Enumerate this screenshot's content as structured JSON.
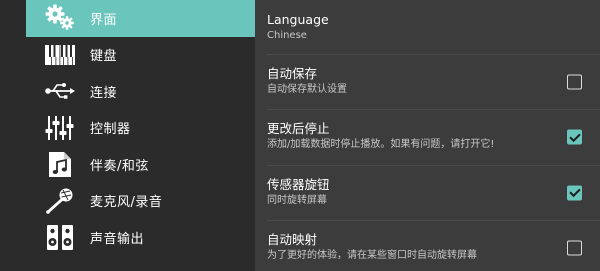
{
  "colors": {
    "accent": "#6ac5bc",
    "sidebar_bg": "#2b2b2b",
    "content_bg": "#3c3c3c"
  },
  "sidebar": {
    "items": [
      {
        "label": "界面",
        "icon": "gears-icon",
        "active": true
      },
      {
        "label": "键盘",
        "icon": "piano-keyboard-icon",
        "active": false
      },
      {
        "label": "连接",
        "icon": "usb-icon",
        "active": false
      },
      {
        "label": "控制器",
        "icon": "sliders-icon",
        "active": false
      },
      {
        "label": "伴奏/和弦",
        "icon": "music-file-icon",
        "active": false
      },
      {
        "label": "麦克风/录音",
        "icon": "microphone-icon",
        "active": false
      },
      {
        "label": "声音输出",
        "icon": "speakers-icon",
        "active": false
      }
    ]
  },
  "settings": {
    "language": {
      "title": "Language",
      "value": "Chinese"
    },
    "auto_save": {
      "title": "自动保存",
      "subtitle": "自动保存默认设置",
      "checked": false
    },
    "stop_after_change": {
      "title": "更改后停止",
      "subtitle": "添加/加载数据时停止播放。如果有问题，请打开它!",
      "checked": true
    },
    "sensor_rotate": {
      "title": "传感器旋钮",
      "subtitle": "同时旋转屏幕",
      "checked": true
    },
    "auto_mirror": {
      "title": "自动映射",
      "subtitle": "为了更好的体验，请在某些窗口时自动旋转屏幕",
      "checked": false
    }
  }
}
